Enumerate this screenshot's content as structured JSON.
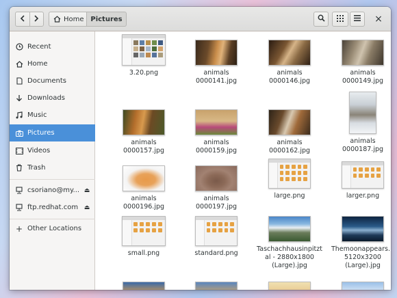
{
  "header": {
    "back_icon": "back-arrow-icon",
    "forward_icon": "forward-arrow-icon",
    "breadcrumbs": [
      {
        "label": "Home",
        "icon": "home-icon"
      },
      {
        "label": "Pictures"
      }
    ],
    "search_icon": "search-icon",
    "view_icon": "grid-view-icon",
    "menu_icon": "hamburger-menu-icon",
    "close_label": "×"
  },
  "sidebar": {
    "items": [
      {
        "label": "Recent",
        "icon": "clock-icon"
      },
      {
        "label": "Home",
        "icon": "home-icon"
      },
      {
        "label": "Documents",
        "icon": "document-icon"
      },
      {
        "label": "Downloads",
        "icon": "download-icon"
      },
      {
        "label": "Music",
        "icon": "music-icon"
      },
      {
        "label": "Pictures",
        "icon": "camera-icon",
        "selected": true
      },
      {
        "label": "Videos",
        "icon": "video-icon"
      },
      {
        "label": "Trash",
        "icon": "trash-icon"
      }
    ],
    "mounts": [
      {
        "label": "csoriano@my...",
        "icon": "network-drive-icon",
        "eject": "⏏"
      },
      {
        "label": "ftp.redhat.com",
        "icon": "network-drive-icon",
        "eject": "⏏"
      }
    ],
    "other": {
      "label": "Other Locations",
      "icon": "plus-icon"
    }
  },
  "files": [
    {
      "name": "3.20.png"
    },
    {
      "name": "animals 0000141.jpg"
    },
    {
      "name": "animals 0000146.jpg"
    },
    {
      "name": "animals 0000149.jpg"
    },
    {
      "name": "animals 0000157.jpg"
    },
    {
      "name": "animals 0000159.jpg"
    },
    {
      "name": "animals 0000162.jpg"
    },
    {
      "name": "animals 0000187.jpg"
    },
    {
      "name": "animals 0000196.jpg"
    },
    {
      "name": "animals 0000197.jpg"
    },
    {
      "name": "large.png"
    },
    {
      "name": "larger.png"
    },
    {
      "name": "small.png"
    },
    {
      "name": "standard.png"
    },
    {
      "name": "Taschachhausinpitztal - 2880x1800 (Large).jpg"
    },
    {
      "name": "Themoonappears... 5120x3200 (Large).jpg"
    },
    {
      "name": ""
    },
    {
      "name": ""
    },
    {
      "name": ""
    },
    {
      "name": ""
    }
  ],
  "colors": {
    "accent": "#4a90d9",
    "sidebar_bg": "#f6f5f4",
    "folder": "#e6a243"
  }
}
